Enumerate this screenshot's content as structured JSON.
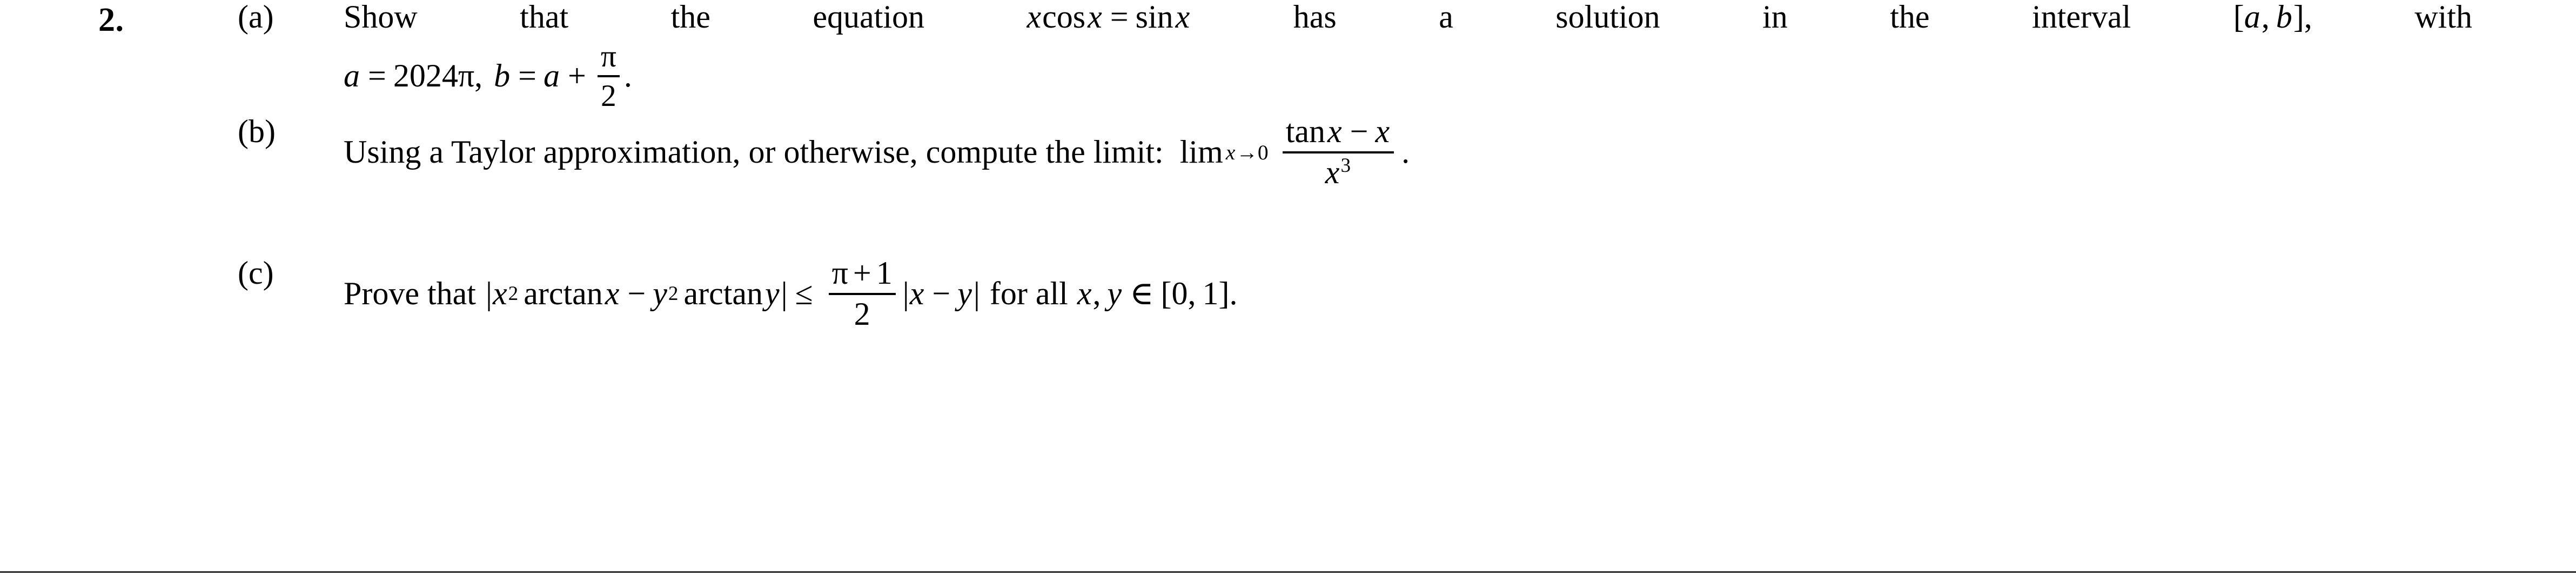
{
  "document": {
    "problem_number": "2.",
    "parts": [
      {
        "label": "(a)",
        "line1": {
          "w1": "Show",
          "w2": "that",
          "w3": "the",
          "w4": "equation",
          "math_x": "x",
          "math_cos": "cos",
          "math_x2": "x",
          "math_eq": "=",
          "math_sin": "sin",
          "math_x3": "x",
          "w5": "has",
          "w6": "a",
          "w7": "solution",
          "w8": "in",
          "w9": "the",
          "w10": "interval",
          "interval_open": "[",
          "interval_a": "a",
          "interval_comma": ",",
          "interval_b": "b",
          "interval_close": "]",
          "interval_trail": ",",
          "w11": "with"
        },
        "line2": {
          "var_a": "a",
          "eq1": "=",
          "coef": "2024",
          "pi": "π",
          "comma": ",",
          "var_b": "b",
          "eq2": "=",
          "var_a2": "a",
          "plus": "+",
          "frac_num": "π",
          "frac_den": "2",
          "period": "."
        }
      },
      {
        "label": "(b)",
        "text_before": "Using a Taylor approximation, or otherwise, compute the limit:",
        "limit_op": "lim",
        "limit_sub_var": "x",
        "limit_sub_arrow": "→",
        "limit_sub_target": "0",
        "frac_num_tan": "tan",
        "frac_num_x1": "x",
        "frac_num_minus": "−",
        "frac_num_x2": "x",
        "frac_den_x": "x",
        "frac_den_exp": "3",
        "period": "."
      },
      {
        "label": "(c)",
        "text_before": "Prove that",
        "bar_open": "|",
        "x_var": "x",
        "x_exp": "2",
        "arctan1": "arctan",
        "x_var2": "x",
        "minus": "−",
        "y_var": "y",
        "y_exp": "2",
        "arctan2": "arctan",
        "y_var2": "y",
        "bar_close": "|",
        "leq": "≤",
        "frac_num_pi": "π",
        "frac_num_plus": "+",
        "frac_num_one": "1",
        "frac_den": "2",
        "bar_open2": "|",
        "diff_x": "x",
        "diff_minus": "−",
        "diff_y": "y",
        "bar_close2": "|",
        "text_after": "for all",
        "set_x": "x",
        "set_comma": ",",
        "set_y": "y",
        "set_in": "∈",
        "set_open": "[",
        "set_zero": "0",
        "set_sep": ",",
        "set_one": "1",
        "set_close": "]",
        "period": "."
      }
    ]
  },
  "colors": {
    "text": "#000000",
    "rule": "#2b2b2b",
    "background": "#ffffff"
  }
}
